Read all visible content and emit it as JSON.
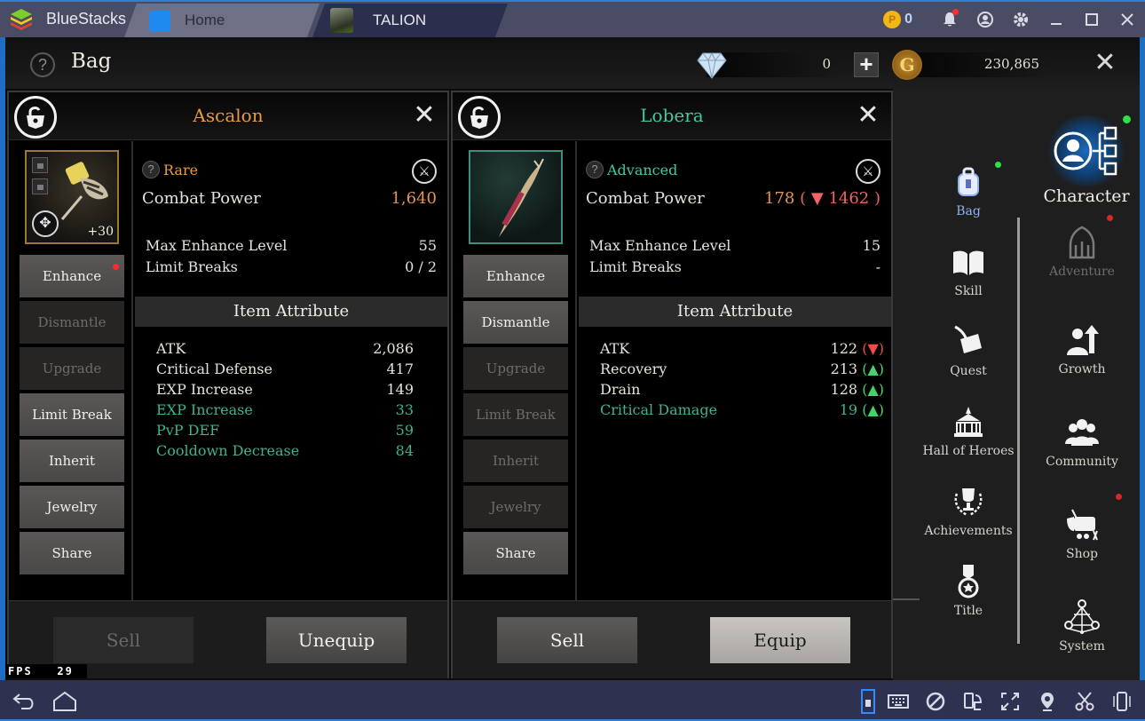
{
  "titlebar": {
    "app_name": "BlueStacks",
    "tabs": [
      {
        "label": "Home",
        "icon": "home-icon"
      },
      {
        "label": "TALION",
        "icon": "talion-game-icon"
      }
    ],
    "coin_count": "0",
    "coin_symbol": "P",
    "icons": [
      "bell-icon",
      "account-icon",
      "gear-icon",
      "minimize-icon",
      "maximize-icon",
      "close-icon"
    ]
  },
  "header": {
    "title": "Bag",
    "help": "?",
    "diamonds": "0",
    "plus": "+",
    "gold_symbol": "G",
    "gold": "230,865",
    "close": "✕"
  },
  "panels": [
    {
      "name": "Ascalon",
      "grade": "Rare",
      "enhance_level": "+30",
      "combat_power_label": "Combat Power",
      "combat_power": "1,640",
      "stats": [
        {
          "label": "Max Enhance Level",
          "value": "55"
        },
        {
          "label": "Limit Breaks",
          "value": "0 / 2"
        }
      ],
      "attr_header": "Item Attribute",
      "attributes": [
        {
          "label": "ATK",
          "value": "2,086",
          "bonus": false
        },
        {
          "label": "Critical Defense",
          "value": "417",
          "bonus": false
        },
        {
          "label": "EXP Increase",
          "value": "149",
          "bonus": false
        },
        {
          "label": "EXP Increase",
          "value": "33",
          "bonus": true
        },
        {
          "label": "PvP DEF",
          "value": "59",
          "bonus": true
        },
        {
          "label": "Cooldown Decrease",
          "value": "84",
          "bonus": true
        }
      ],
      "actions": [
        {
          "label": "Enhance",
          "enabled": true,
          "dot": true
        },
        {
          "label": "Dismantle",
          "enabled": false
        },
        {
          "label": "Upgrade",
          "enabled": false
        },
        {
          "label": "Limit Break",
          "enabled": true
        },
        {
          "label": "Inherit",
          "enabled": true
        },
        {
          "label": "Jewelry",
          "enabled": true
        },
        {
          "label": "Share",
          "enabled": true
        }
      ],
      "sell_label": "Sell",
      "main_label": "Unequip"
    },
    {
      "name": "Lobera",
      "grade": "Advanced",
      "combat_power_label": "Combat Power",
      "combat_power": "178",
      "combat_power_delta": "1462",
      "stats": [
        {
          "label": "Max Enhance Level",
          "value": "15"
        },
        {
          "label": "Limit Breaks",
          "value": "-"
        }
      ],
      "attr_header": "Item Attribute",
      "attributes": [
        {
          "label": "ATK",
          "value": "122",
          "bonus": false,
          "trend": "down"
        },
        {
          "label": "Recovery",
          "value": "213",
          "bonus": false,
          "trend": "up"
        },
        {
          "label": "Drain",
          "value": "128",
          "bonus": false,
          "trend": "up"
        },
        {
          "label": "Critical Damage",
          "value": "19",
          "bonus": true,
          "trend": "up"
        }
      ],
      "actions": [
        {
          "label": "Enhance",
          "enabled": true
        },
        {
          "label": "Dismantle",
          "enabled": true
        },
        {
          "label": "Upgrade",
          "enabled": false
        },
        {
          "label": "Limit Break",
          "enabled": false
        },
        {
          "label": "Inherit",
          "enabled": false
        },
        {
          "label": "Jewelry",
          "enabled": false
        },
        {
          "label": "Share",
          "enabled": true
        }
      ],
      "sell_label": "Sell",
      "main_label": "Equip"
    }
  ],
  "menu": {
    "character": "Character",
    "left": [
      {
        "label": "Bag",
        "icon": "bag-icon",
        "active": true,
        "dot": "green"
      },
      {
        "label": "Skill",
        "icon": "book-icon"
      },
      {
        "label": "Quest",
        "icon": "scroll-quill-icon"
      },
      {
        "label": "Hall of Heroes",
        "icon": "palace-icon"
      },
      {
        "label": "Achievements",
        "icon": "trophy-laurel-icon"
      },
      {
        "label": "Title",
        "icon": "medal-icon"
      }
    ],
    "right": [
      {
        "label": "Adventure",
        "icon": "dragon-gate-icon",
        "dim": true,
        "dot": "red"
      },
      {
        "label": "Growth",
        "icon": "growth-arrow-icon"
      },
      {
        "label": "Community",
        "icon": "people-icon"
      },
      {
        "label": "Shop",
        "icon": "treasure-chest-icon",
        "dot": "red"
      },
      {
        "label": "System",
        "icon": "network-icon"
      }
    ]
  },
  "fps": {
    "label": "FPS",
    "value": "29"
  },
  "colors": {
    "rare": "#e79a45",
    "advanced": "#43c99d",
    "bonus_attr": "#3fb38c",
    "up": "#49d16b",
    "down": "#ef4b4b",
    "accent_blue": "#2f7fd3"
  }
}
